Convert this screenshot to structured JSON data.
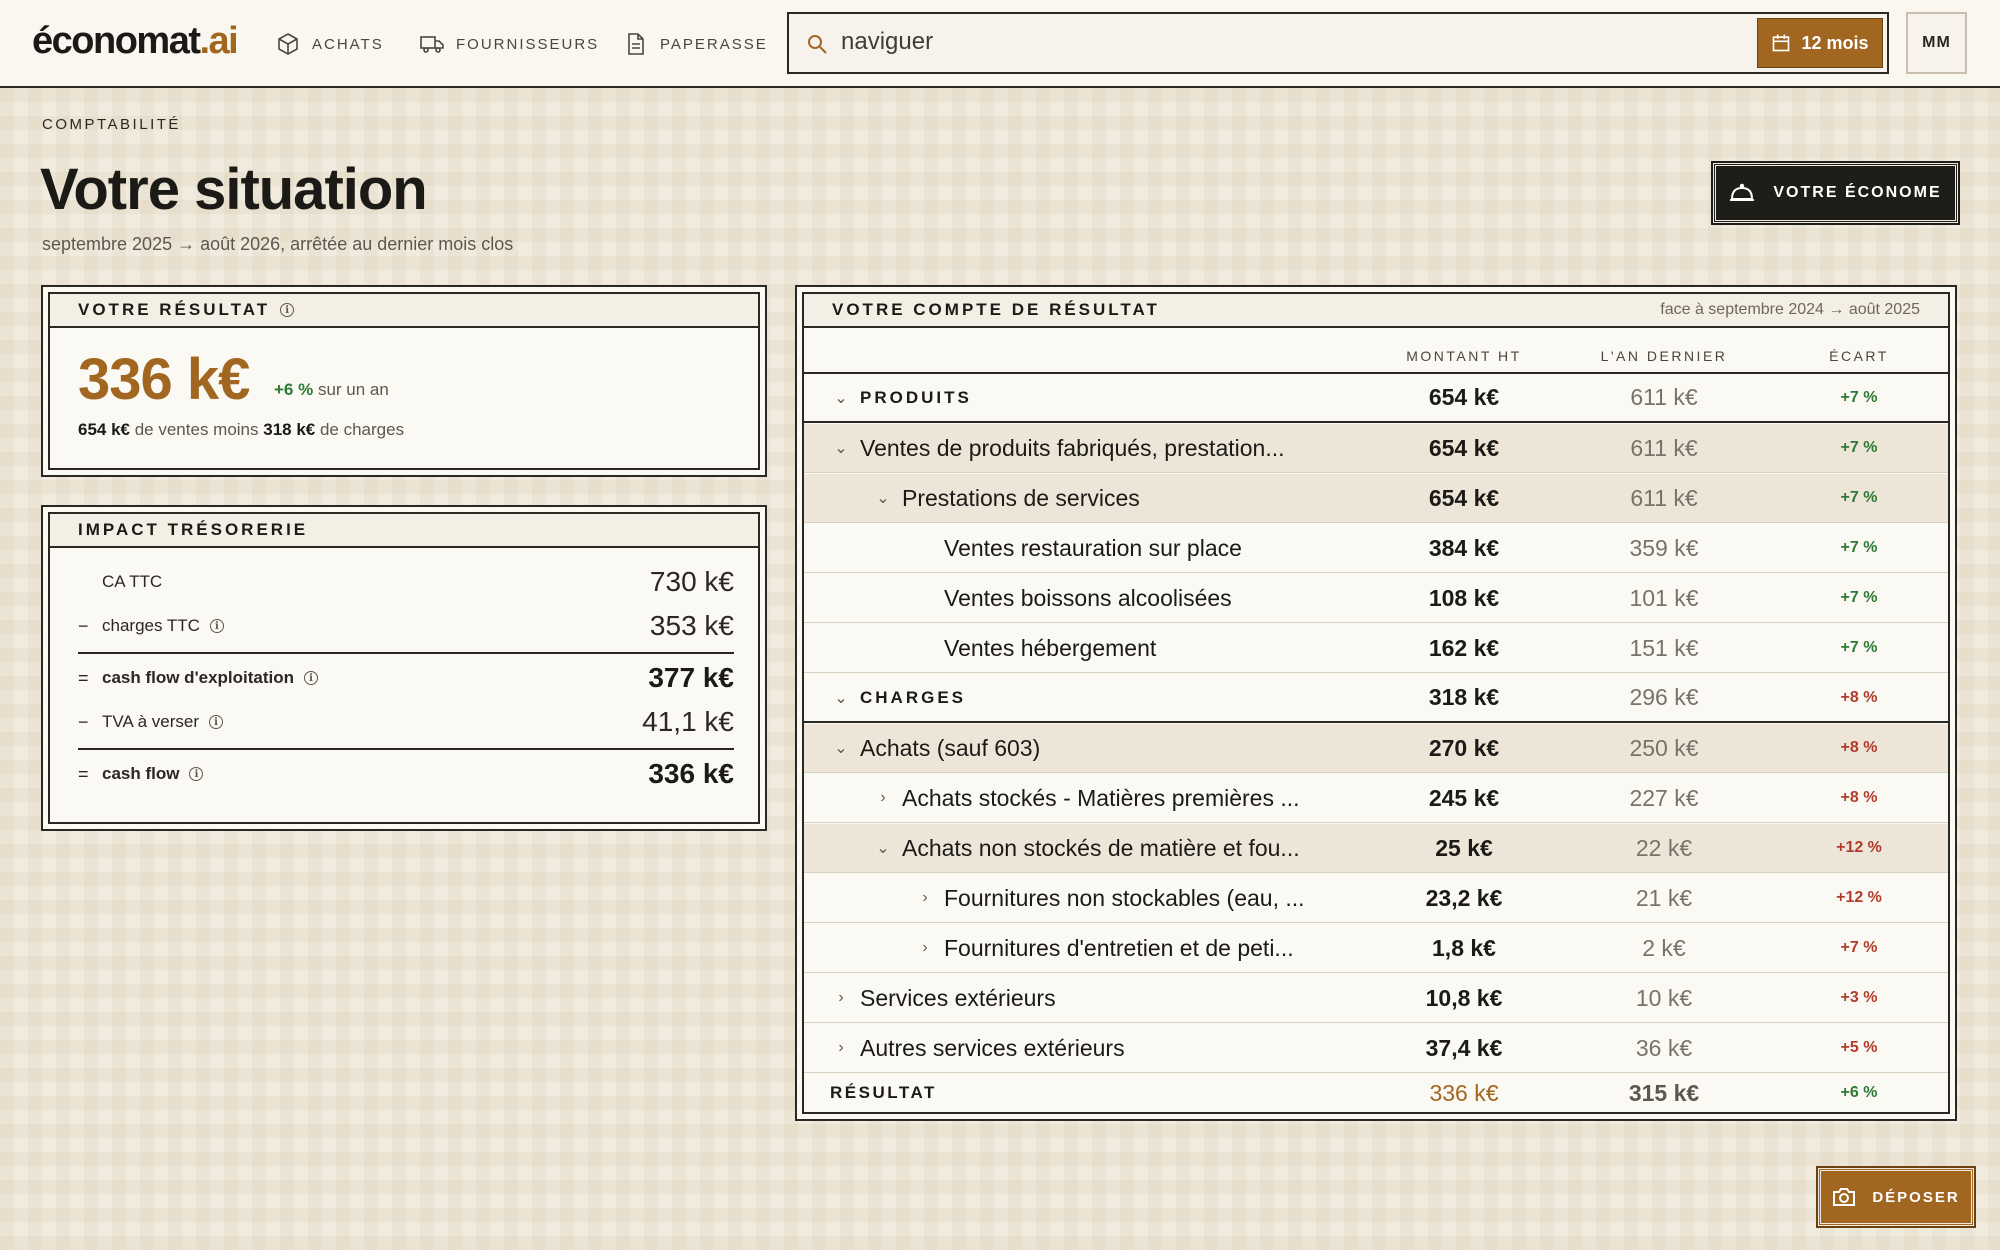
{
  "app": {
    "logo_main": "économat",
    "logo_accent": ".ai"
  },
  "nav": {
    "achats": "ACHATS",
    "fournisseurs": "FOURNISSEURS",
    "paperasse": "PAPERASSE"
  },
  "search": {
    "placeholder": "naviguer",
    "period_label": "12 mois"
  },
  "user": {
    "initials": "MM"
  },
  "header": {
    "breadcrumb": "COMPTABILITÉ",
    "title": "Votre situation",
    "subtitle": "septembre 2025 → août 2026, arrêtée au dernier mois clos",
    "econome_button": "VOTRE ÉCONOME"
  },
  "result_card": {
    "title": "VOTRE RÉSULTAT",
    "value": "336 k€",
    "change_pct": "+6 %",
    "change_suffix": " sur un an",
    "sales": "654 k€",
    "sales_suffix": " de ventes moins ",
    "charges": "318 k€",
    "charges_suffix": " de charges"
  },
  "treasury": {
    "title": "IMPACT TRÉSORERIE",
    "rows": [
      {
        "prefix": "",
        "label": "CA TTC",
        "value": "730 k€"
      },
      {
        "prefix": "−",
        "label": "charges TTC",
        "value": "353 k€"
      },
      {
        "prefix": "=",
        "label": "cash flow d'exploitation",
        "value": "377 k€"
      },
      {
        "prefix": "−",
        "label": "TVA à verser",
        "value": "41,1 k€"
      },
      {
        "prefix": "=",
        "label": "cash flow",
        "value": "336 k€"
      }
    ]
  },
  "pnl": {
    "title": "VOTRE COMPTE DE RÉSULTAT",
    "comparison": "face à septembre 2024 → août 2025",
    "columns": [
      "MONTANT HT",
      "L'AN DERNIER",
      "ÉCART"
    ],
    "rows": [
      {
        "label": "PRODUITS",
        "amount": "654 k€",
        "previous": "611 k€",
        "delta": "+7 %"
      },
      {
        "label": "Ventes de produits fabriqués, prestation...",
        "amount": "654 k€",
        "previous": "611 k€",
        "delta": "+7 %"
      },
      {
        "label": "Prestations de services",
        "amount": "654 k€",
        "previous": "611 k€",
        "delta": "+7 %"
      },
      {
        "label": "Ventes restauration sur place",
        "amount": "384 k€",
        "previous": "359 k€",
        "delta": "+7 %"
      },
      {
        "label": "Ventes boissons alcoolisées",
        "amount": "108 k€",
        "previous": "101 k€",
        "delta": "+7 %"
      },
      {
        "label": "Ventes hébergement",
        "amount": "162 k€",
        "previous": "151 k€",
        "delta": "+7 %"
      },
      {
        "label": "CHARGES",
        "amount": "318 k€",
        "previous": "296 k€",
        "delta": "+8 %"
      },
      {
        "label": "Achats (sauf 603)",
        "amount": "270 k€",
        "previous": "250 k€",
        "delta": "+8 %"
      },
      {
        "label": "Achats stockés - Matières premières ...",
        "amount": "245 k€",
        "previous": "227 k€",
        "delta": "+8 %"
      },
      {
        "label": "Achats non stockés de matière et fou...",
        "amount": "25 k€",
        "previous": "22 k€",
        "delta": "+12 %"
      },
      {
        "label": "Fournitures non stockables (eau, ...",
        "amount": "23,2 k€",
        "previous": "21 k€",
        "delta": "+12 %"
      },
      {
        "label": "Fournitures d'entretien et de peti...",
        "amount": "1,8 k€",
        "previous": "2 k€",
        "delta": "+7 %"
      },
      {
        "label": "Services extérieurs",
        "amount": "10,8 k€",
        "previous": "10 k€",
        "delta": "+3 %"
      },
      {
        "label": "Autres services extérieurs",
        "amount": "37,4 k€",
        "previous": "36 k€",
        "delta": "+5 %"
      },
      {
        "label": "RÉSULTAT",
        "amount": "336 k€",
        "previous": "315 k€",
        "delta": "+6 %"
      }
    ]
  },
  "deposer_button": "DÉPOSER",
  "colors": {
    "accent": "#a1661f",
    "positive": "#2c7a34",
    "negative": "#b33b2a",
    "ink": "#1c1a17"
  }
}
